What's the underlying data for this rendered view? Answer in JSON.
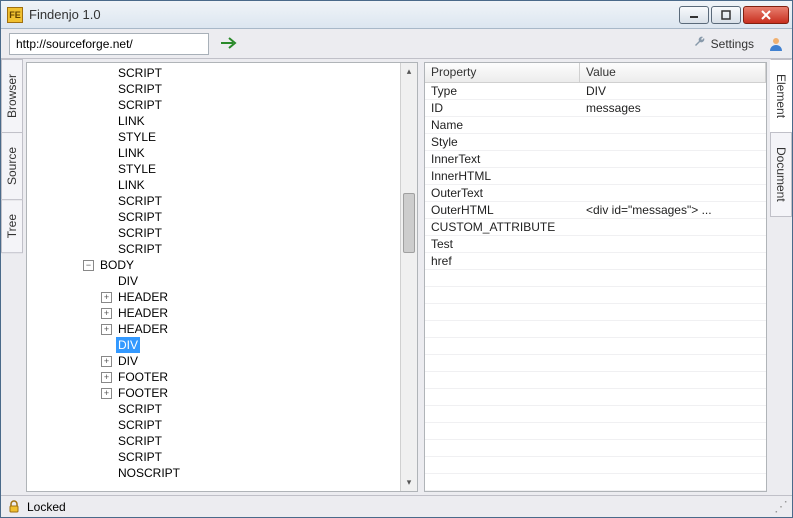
{
  "window": {
    "title": "Findenjo 1.0",
    "app_icon_text": "FE"
  },
  "toolbar": {
    "url": "http://sourceforge.net/",
    "settings_label": "Settings"
  },
  "left_tabs": [
    "Browser",
    "Source",
    "Tree"
  ],
  "right_tabs": [
    "Element",
    "Document"
  ],
  "tree": {
    "active_right_tab": 0,
    "nodes": [
      {
        "depth": 3,
        "exp": "",
        "label": "SCRIPT"
      },
      {
        "depth": 3,
        "exp": "",
        "label": "SCRIPT"
      },
      {
        "depth": 3,
        "exp": "",
        "label": "SCRIPT"
      },
      {
        "depth": 3,
        "exp": "",
        "label": "LINK"
      },
      {
        "depth": 3,
        "exp": "",
        "label": "STYLE"
      },
      {
        "depth": 3,
        "exp": "",
        "label": "LINK"
      },
      {
        "depth": 3,
        "exp": "",
        "label": "STYLE"
      },
      {
        "depth": 3,
        "exp": "",
        "label": "LINK"
      },
      {
        "depth": 3,
        "exp": "",
        "label": "SCRIPT"
      },
      {
        "depth": 3,
        "exp": "",
        "label": "SCRIPT"
      },
      {
        "depth": 3,
        "exp": "",
        "label": "SCRIPT"
      },
      {
        "depth": 3,
        "exp": "",
        "label": "SCRIPT"
      },
      {
        "depth": 2,
        "exp": "-",
        "label": "BODY"
      },
      {
        "depth": 3,
        "exp": "",
        "label": "DIV"
      },
      {
        "depth": 3,
        "exp": "+",
        "label": "HEADER"
      },
      {
        "depth": 3,
        "exp": "+",
        "label": "HEADER"
      },
      {
        "depth": 3,
        "exp": "+",
        "label": "HEADER"
      },
      {
        "depth": 3,
        "exp": "",
        "label": "DIV",
        "selected": true
      },
      {
        "depth": 3,
        "exp": "+",
        "label": "DIV"
      },
      {
        "depth": 3,
        "exp": "+",
        "label": "FOOTER"
      },
      {
        "depth": 3,
        "exp": "+",
        "label": "FOOTER"
      },
      {
        "depth": 3,
        "exp": "",
        "label": "SCRIPT"
      },
      {
        "depth": 3,
        "exp": "",
        "label": "SCRIPT"
      },
      {
        "depth": 3,
        "exp": "",
        "label": "SCRIPT"
      },
      {
        "depth": 3,
        "exp": "",
        "label": "SCRIPT"
      },
      {
        "depth": 3,
        "exp": "",
        "label": "NOSCRIPT"
      }
    ]
  },
  "properties": {
    "headers": {
      "property": "Property",
      "value": "Value"
    },
    "rows": [
      {
        "property": "Type",
        "value": "DIV"
      },
      {
        "property": "ID",
        "value": "messages"
      },
      {
        "property": "Name",
        "value": ""
      },
      {
        "property": "Style",
        "value": ""
      },
      {
        "property": "InnerText",
        "value": ""
      },
      {
        "property": "InnerHTML",
        "value": ""
      },
      {
        "property": "OuterText",
        "value": ""
      },
      {
        "property": "OuterHTML",
        "value": "<div id=\"messages\">    ..."
      },
      {
        "property": "CUSTOM_ATTRIBUTE",
        "value": ""
      },
      {
        "property": "Test",
        "value": ""
      },
      {
        "property": "href",
        "value": ""
      }
    ]
  },
  "statusbar": {
    "text": "Locked"
  }
}
